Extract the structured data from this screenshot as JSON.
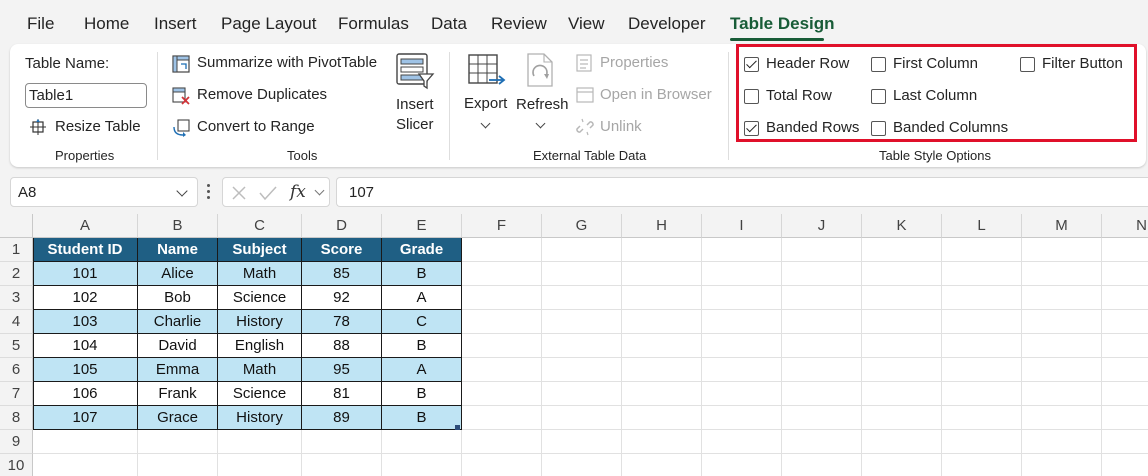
{
  "menu": {
    "tabs": [
      {
        "label": "File"
      },
      {
        "label": "Home"
      },
      {
        "label": "Insert"
      },
      {
        "label": "Page Layout"
      },
      {
        "label": "Formulas"
      },
      {
        "label": "Data"
      },
      {
        "label": "Review"
      },
      {
        "label": "View"
      },
      {
        "label": "Developer"
      },
      {
        "label": "Table Design",
        "active": true
      }
    ],
    "accent_color": "#185c37"
  },
  "ribbon": {
    "properties": {
      "table_name_label": "Table Name:",
      "table_name_value": "Table1",
      "resize_label": "Resize Table",
      "group_label": "Properties"
    },
    "tools": {
      "summarize_label": "Summarize with PivotTable",
      "remove_duplicates_label": "Remove Duplicates",
      "convert_label": "Convert to Range",
      "insert_slicer_line1": "Insert",
      "insert_slicer_line2": "Slicer",
      "group_label": "Tools"
    },
    "external": {
      "export_label": "Export",
      "refresh_label": "Refresh",
      "properties_label": "Properties",
      "open_browser_label": "Open in Browser",
      "unlink_label": "Unlink",
      "group_label": "External Table Data"
    },
    "style_options": {
      "group_label": "Table Style Options",
      "highlight_color": "#e0102a",
      "options": [
        {
          "label": "Header Row",
          "checked": true
        },
        {
          "label": "Total Row",
          "checked": false
        },
        {
          "label": "Banded Rows",
          "checked": true
        },
        {
          "label": "First Column",
          "checked": false
        },
        {
          "label": "Last Column",
          "checked": false
        },
        {
          "label": "Banded Columns",
          "checked": false
        },
        {
          "label": "Filter Button",
          "checked": false
        }
      ]
    }
  },
  "formula_bar": {
    "name_box": "A8",
    "fx_label": "fx",
    "value": "107"
  },
  "sheet": {
    "columns": [
      "A",
      "B",
      "C",
      "D",
      "E",
      "F",
      "G",
      "H",
      "I",
      "J",
      "K",
      "L",
      "M",
      "N"
    ],
    "rows": [
      "1",
      "2",
      "3",
      "4",
      "5",
      "6",
      "7",
      "8",
      "9",
      "10"
    ],
    "table": {
      "header_color": "#1f5f84",
      "band_color": "#bfe4f4",
      "headers": [
        "Student ID",
        "Name",
        "Subject",
        "Score",
        "Grade"
      ],
      "records": [
        [
          "101",
          "Alice",
          "Math",
          "85",
          "B"
        ],
        [
          "102",
          "Bob",
          "Science",
          "92",
          "A"
        ],
        [
          "103",
          "Charlie",
          "History",
          "78",
          "C"
        ],
        [
          "104",
          "David",
          "English",
          "88",
          "B"
        ],
        [
          "105",
          "Emma",
          "Math",
          "95",
          "A"
        ],
        [
          "106",
          "Frank",
          "Science",
          "81",
          "B"
        ],
        [
          "107",
          "Grace",
          "History",
          "89",
          "B"
        ]
      ]
    }
  }
}
